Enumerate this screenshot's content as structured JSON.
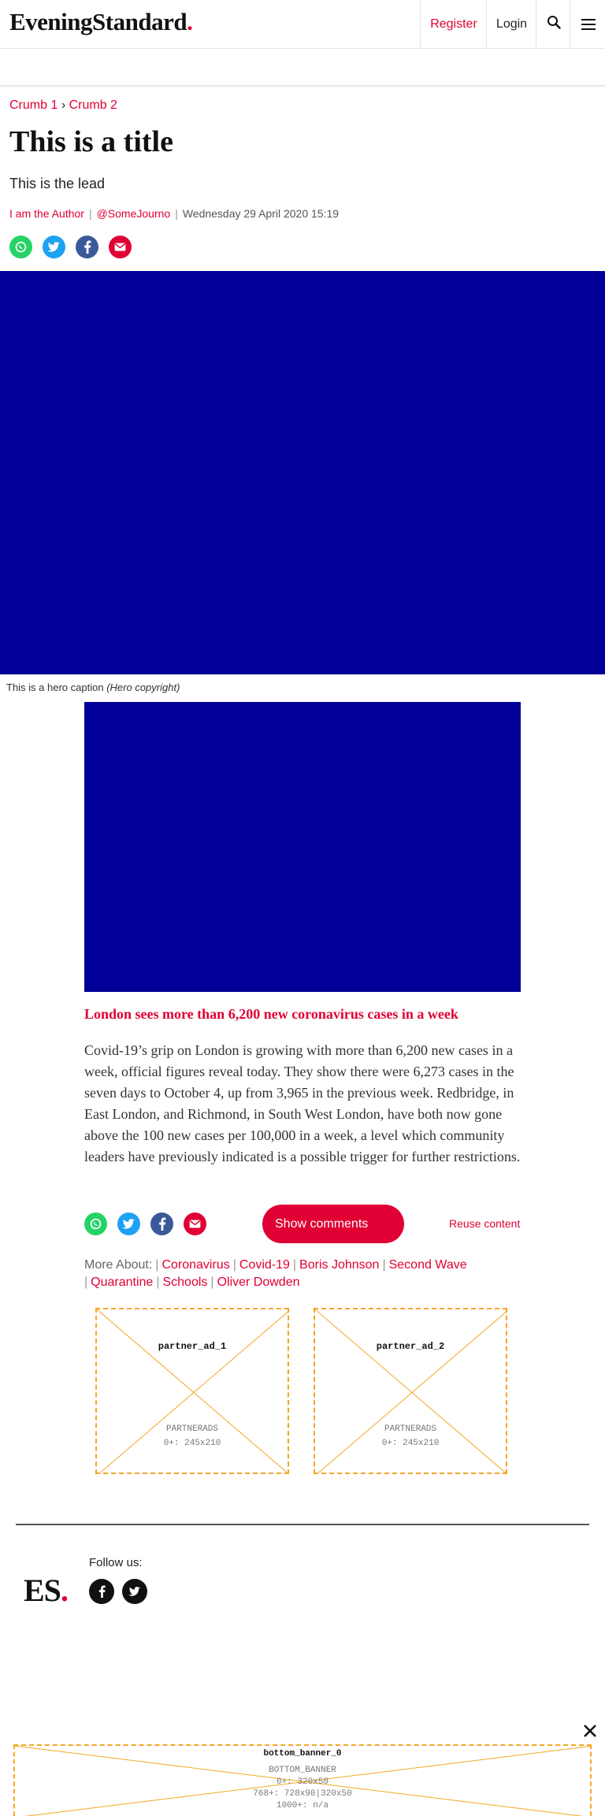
{
  "header": {
    "logo_main": "EveningStandard",
    "logo_dot": ".",
    "register_label": "Register",
    "login_label": "Login",
    "search_icon": "search-icon",
    "menu_icon": "hamburger-menu-icon"
  },
  "breadcrumb": {
    "items": [
      "Crumb 1",
      "Crumb 2"
    ],
    "separator": "›"
  },
  "article": {
    "title": "This is a title",
    "lead": "This is the lead",
    "author": "I am the Author",
    "twitter_handle": "@SomeJourno",
    "date": "Wednesday 29 April 2020 15:19",
    "hero_caption": "This is a hero caption",
    "hero_copyright": "(Hero copyright)",
    "inline_heading": "London sees more than 6,200 new coronavirus cases in a week",
    "body": "Covid-19’s grip on London is growing with more than 6,200 new cases in a week, official figures reveal today. They show there were 6,273 cases in the seven days to October 4, up from 3,965 in the previous week. Redbridge, in East London, and Richmond, in South West London, have both now gone above the 100 new cases per 100,000 in a week, a level which community leaders have previously indicated is a possible trigger for further restrictions."
  },
  "share_icons": [
    "whatsapp-icon",
    "twitter-icon",
    "facebook-icon",
    "email-icon"
  ],
  "actions": {
    "show_comments": "Show comments",
    "reuse_content": "Reuse content"
  },
  "more_about": {
    "label": "More About:",
    "tags": [
      "Coronavirus",
      "Covid-19",
      "Boris Johnson",
      "Second Wave",
      "Quarantine",
      "Schools",
      "Oliver Dowden"
    ]
  },
  "ads": [
    {
      "name": "partner_ad_1",
      "provider": "PARTNERADS",
      "sizes": "0+: 245x210"
    },
    {
      "name": "partner_ad_2",
      "provider": "PARTNERADS",
      "sizes": "0+: 245x210"
    }
  ],
  "footer": {
    "logo": "ES",
    "logo_dot": ".",
    "follow_label": "Follow us:",
    "follow_icons": [
      "facebook-icon",
      "twitter-icon"
    ]
  },
  "bottom_banner": {
    "name": "bottom_banner_0",
    "provider": "BOTTOM_BANNER",
    "lines": [
      "0+: 320x50",
      "768+: 728x90|320x50",
      "1000+: n/a"
    ],
    "close_icon": "close-icon"
  },
  "colors": {
    "brand_red": "#e00033",
    "hero_blue": "#000099",
    "ad_outline": "#f5a623"
  }
}
